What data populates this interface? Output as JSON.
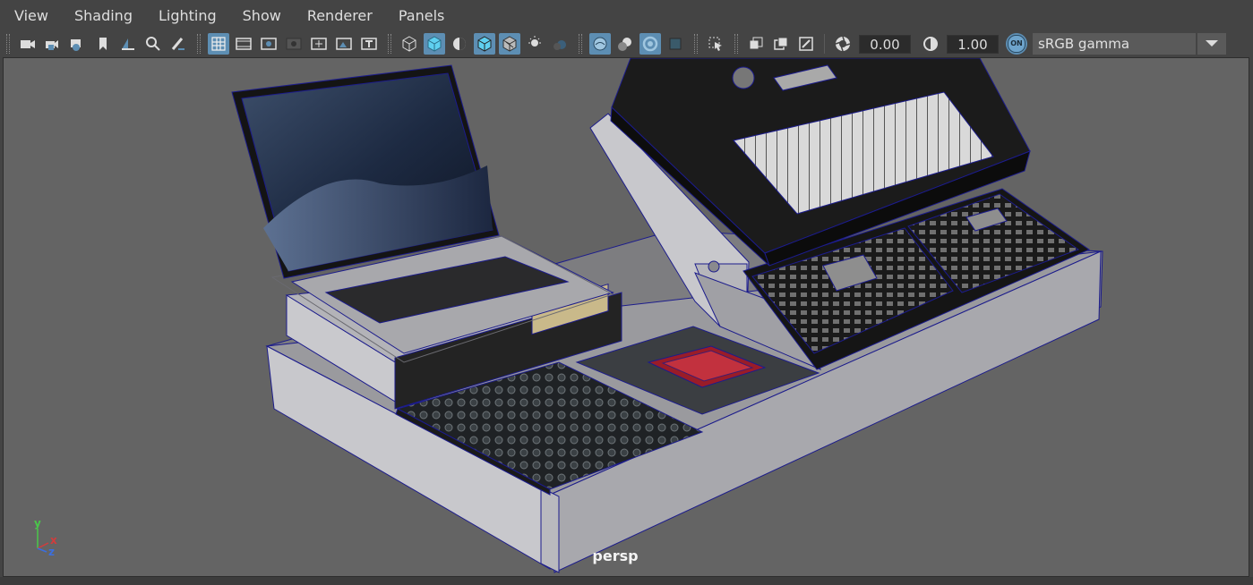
{
  "menu": [
    "View",
    "Shading",
    "Lighting",
    "Show",
    "Renderer",
    "Panels"
  ],
  "toolbar": {
    "groups": [
      [
        "camera-icon",
        "lock-camera-icon",
        "camera-attributes-icon",
        "bookmark-icon",
        "image-plane-icon",
        "frame-selection-icon",
        "paint-brush-icon"
      ],
      [
        "grid-icon",
        "film-gate-icon",
        "resolution-gate-icon",
        "gate-mask-icon",
        "field-chart-icon",
        "safe-action-icon",
        "safe-title-icon"
      ],
      [
        "wireframe-icon",
        "smooth-shade-icon",
        "default-material-icon",
        "wireframe-on-shaded-icon",
        "xray-icon",
        "use-all-lights-icon",
        "shadows-icon"
      ],
      [
        "screen-space-ao-icon",
        "motion-blur-icon",
        "anti-aliasing-icon",
        "depth-of-field-icon"
      ],
      [
        "isolate-select-icon"
      ],
      [
        "xray-joints-icon",
        "xray-active-components-icon",
        "backface-culling-icon"
      ]
    ],
    "active_icons": [
      "grid-icon",
      "smooth-shade-icon",
      "wireframe-on-shaded-icon",
      "xray-icon",
      "screen-space-ao-icon",
      "anti-aliasing-icon"
    ],
    "exposure_value": "0.00",
    "gamma_value": "1.00",
    "color_management_badge": "ON",
    "color_space": "sRGB gamma"
  },
  "viewport": {
    "camera_label": "persp",
    "background_color": "#646464",
    "axis": {
      "y": "y",
      "x": "x",
      "z": "z"
    }
  },
  "colors": {
    "accent": "#5d8eb3",
    "wire": "#1c1c8c",
    "axis_x": "#d23c3c",
    "axis_y": "#49c749",
    "axis_z": "#3b6fe0"
  }
}
